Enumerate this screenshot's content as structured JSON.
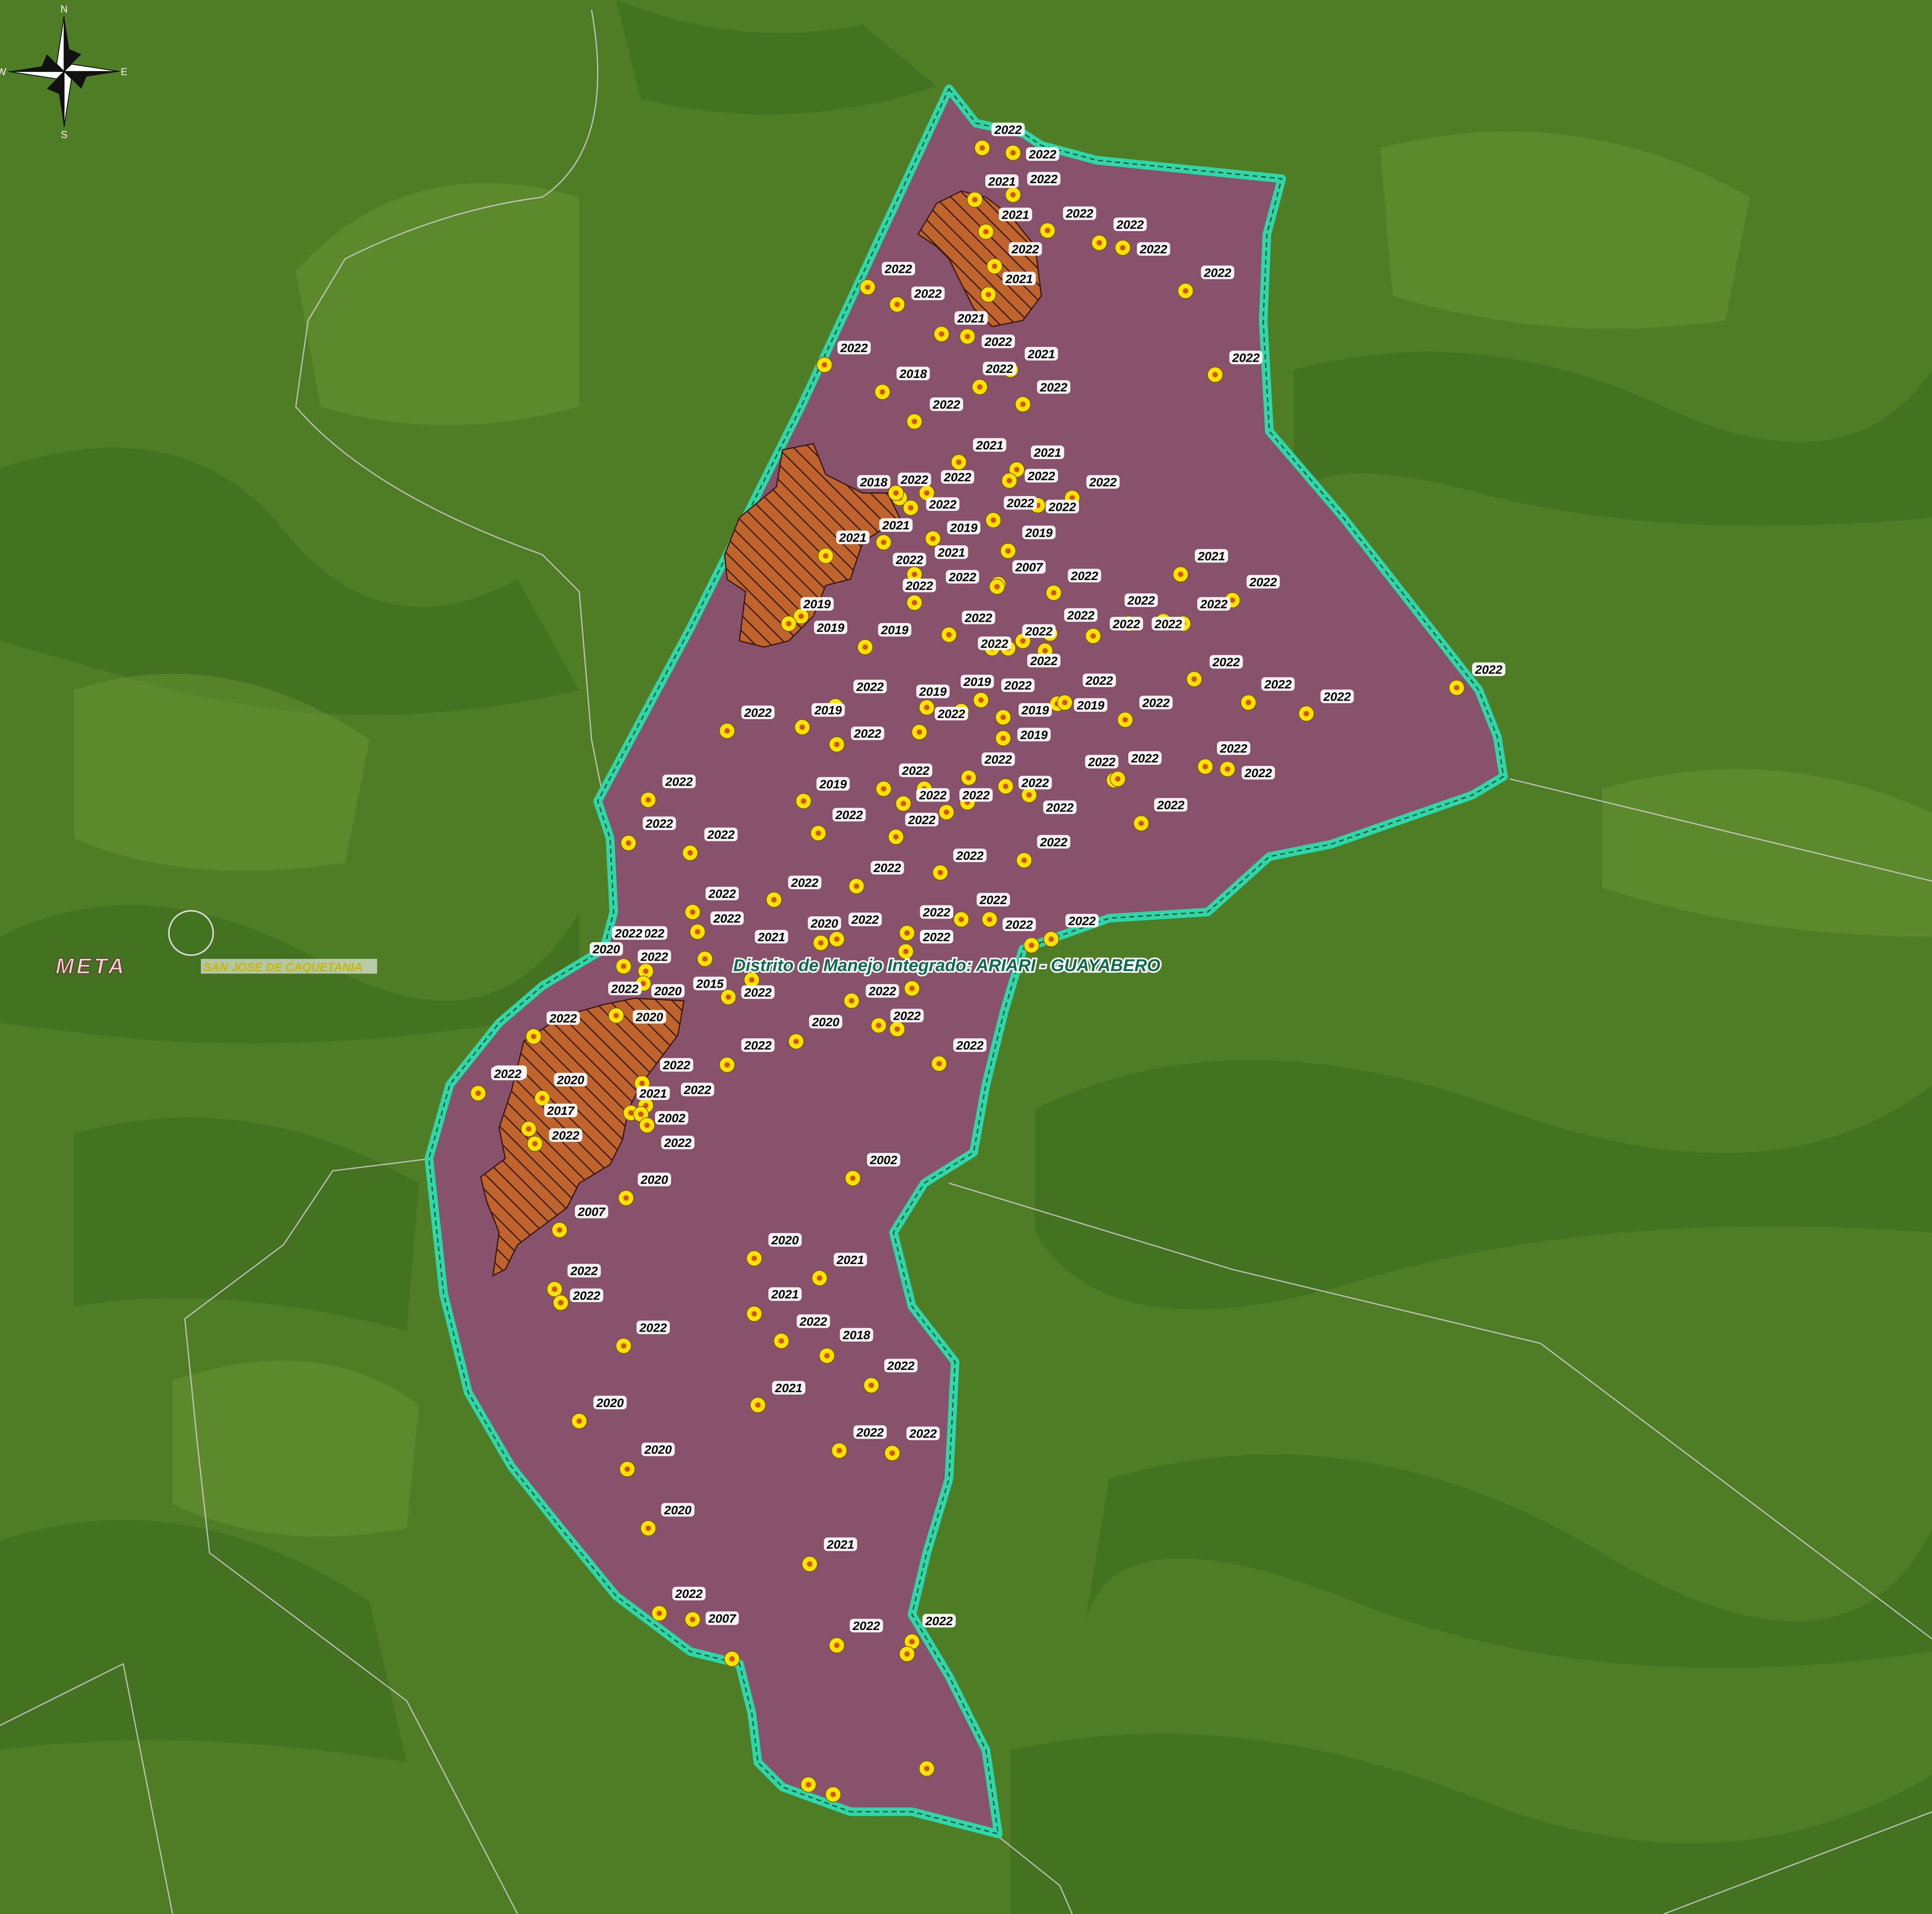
{
  "compass": {
    "n": "N",
    "s": "S",
    "e": "E",
    "w": "W"
  },
  "region_label": "META",
  "town_label": "SAN JOSÉ DE CAQUETANIA",
  "district_label": "Distrito de Manejo Integrado: ARIARI - GUAYABERO",
  "colors": {
    "land": "#4f7d26",
    "district_fill": "#8a4f6e",
    "district_border": "#2fd6a6",
    "degraded_fill": "#c0642e",
    "point_fill": "#ffe200",
    "point_center": "#d45500",
    "label_bg": "#ffffff",
    "label_text": "#000000",
    "district_label_color": "#0e6b4c",
    "town_label_color": "#e8e000",
    "region_label_color": "#f0d0d0"
  },
  "icons": [
    "compass-rose-icon",
    "town-circle-icon",
    "hotspot-point-icon"
  ],
  "hotspot_labels": [
    "2022",
    "2022",
    "2022",
    "2021",
    "2022",
    "2021",
    "2022",
    "2022",
    "2022",
    "2022",
    "2022",
    "2021",
    "2022",
    "2021",
    "2022",
    "2022",
    "2021",
    "2022",
    "2022",
    "2018",
    "2022",
    "2022",
    "2021",
    "2021",
    "2022",
    "2022",
    "2018",
    "2022",
    "2022",
    "2022",
    "2022",
    "2022",
    "2019",
    "2019",
    "2021",
    "2021",
    "2022",
    "2021",
    "2022",
    "2007",
    "2022",
    "2021",
    "2022",
    "2022",
    "2019",
    "2019",
    "2022",
    "2022",
    "2022",
    "2022",
    "2022",
    "2019",
    "2022",
    "2022",
    "2022",
    "2022",
    "2022",
    "2022",
    "2019",
    "2022",
    "2019",
    "2019",
    "2022",
    "2022",
    "2019",
    "2022",
    "2019",
    "2022",
    "2022",
    "2022",
    "2022",
    "2022",
    "2019",
    "2022",
    "2022",
    "2022",
    "2022",
    "2022",
    "2022",
    "2022",
    "2019",
    "2022",
    "2022",
    "2022",
    "2022",
    "2022",
    "2022",
    "2022",
    "2022",
    "2022",
    "2022",
    "2022",
    "2022",
    "2022",
    "2022",
    "2022",
    "2022",
    "2022",
    "2022",
    "2022",
    "2022",
    "2020",
    "2022",
    "2021",
    "2020",
    "2022",
    "2022",
    "2020",
    "2022",
    "2022",
    "2015",
    "2022",
    "2022",
    "2020",
    "2022",
    "2020",
    "2020",
    "2022",
    "2022",
    "2022",
    "2022",
    "2022",
    "2020",
    "2022",
    "2022",
    "2017",
    "2021",
    "2002",
    "2022",
    "2022",
    "2002",
    "2020",
    "2007",
    "2020",
    "2021",
    "2022",
    "2022",
    "2021",
    "2022",
    "2022",
    "2018",
    "2022",
    "2021",
    "2020",
    "2022",
    "2022",
    "2020",
    "2020",
    "2021",
    "2022",
    "2007",
    "2022",
    "2022"
  ]
}
